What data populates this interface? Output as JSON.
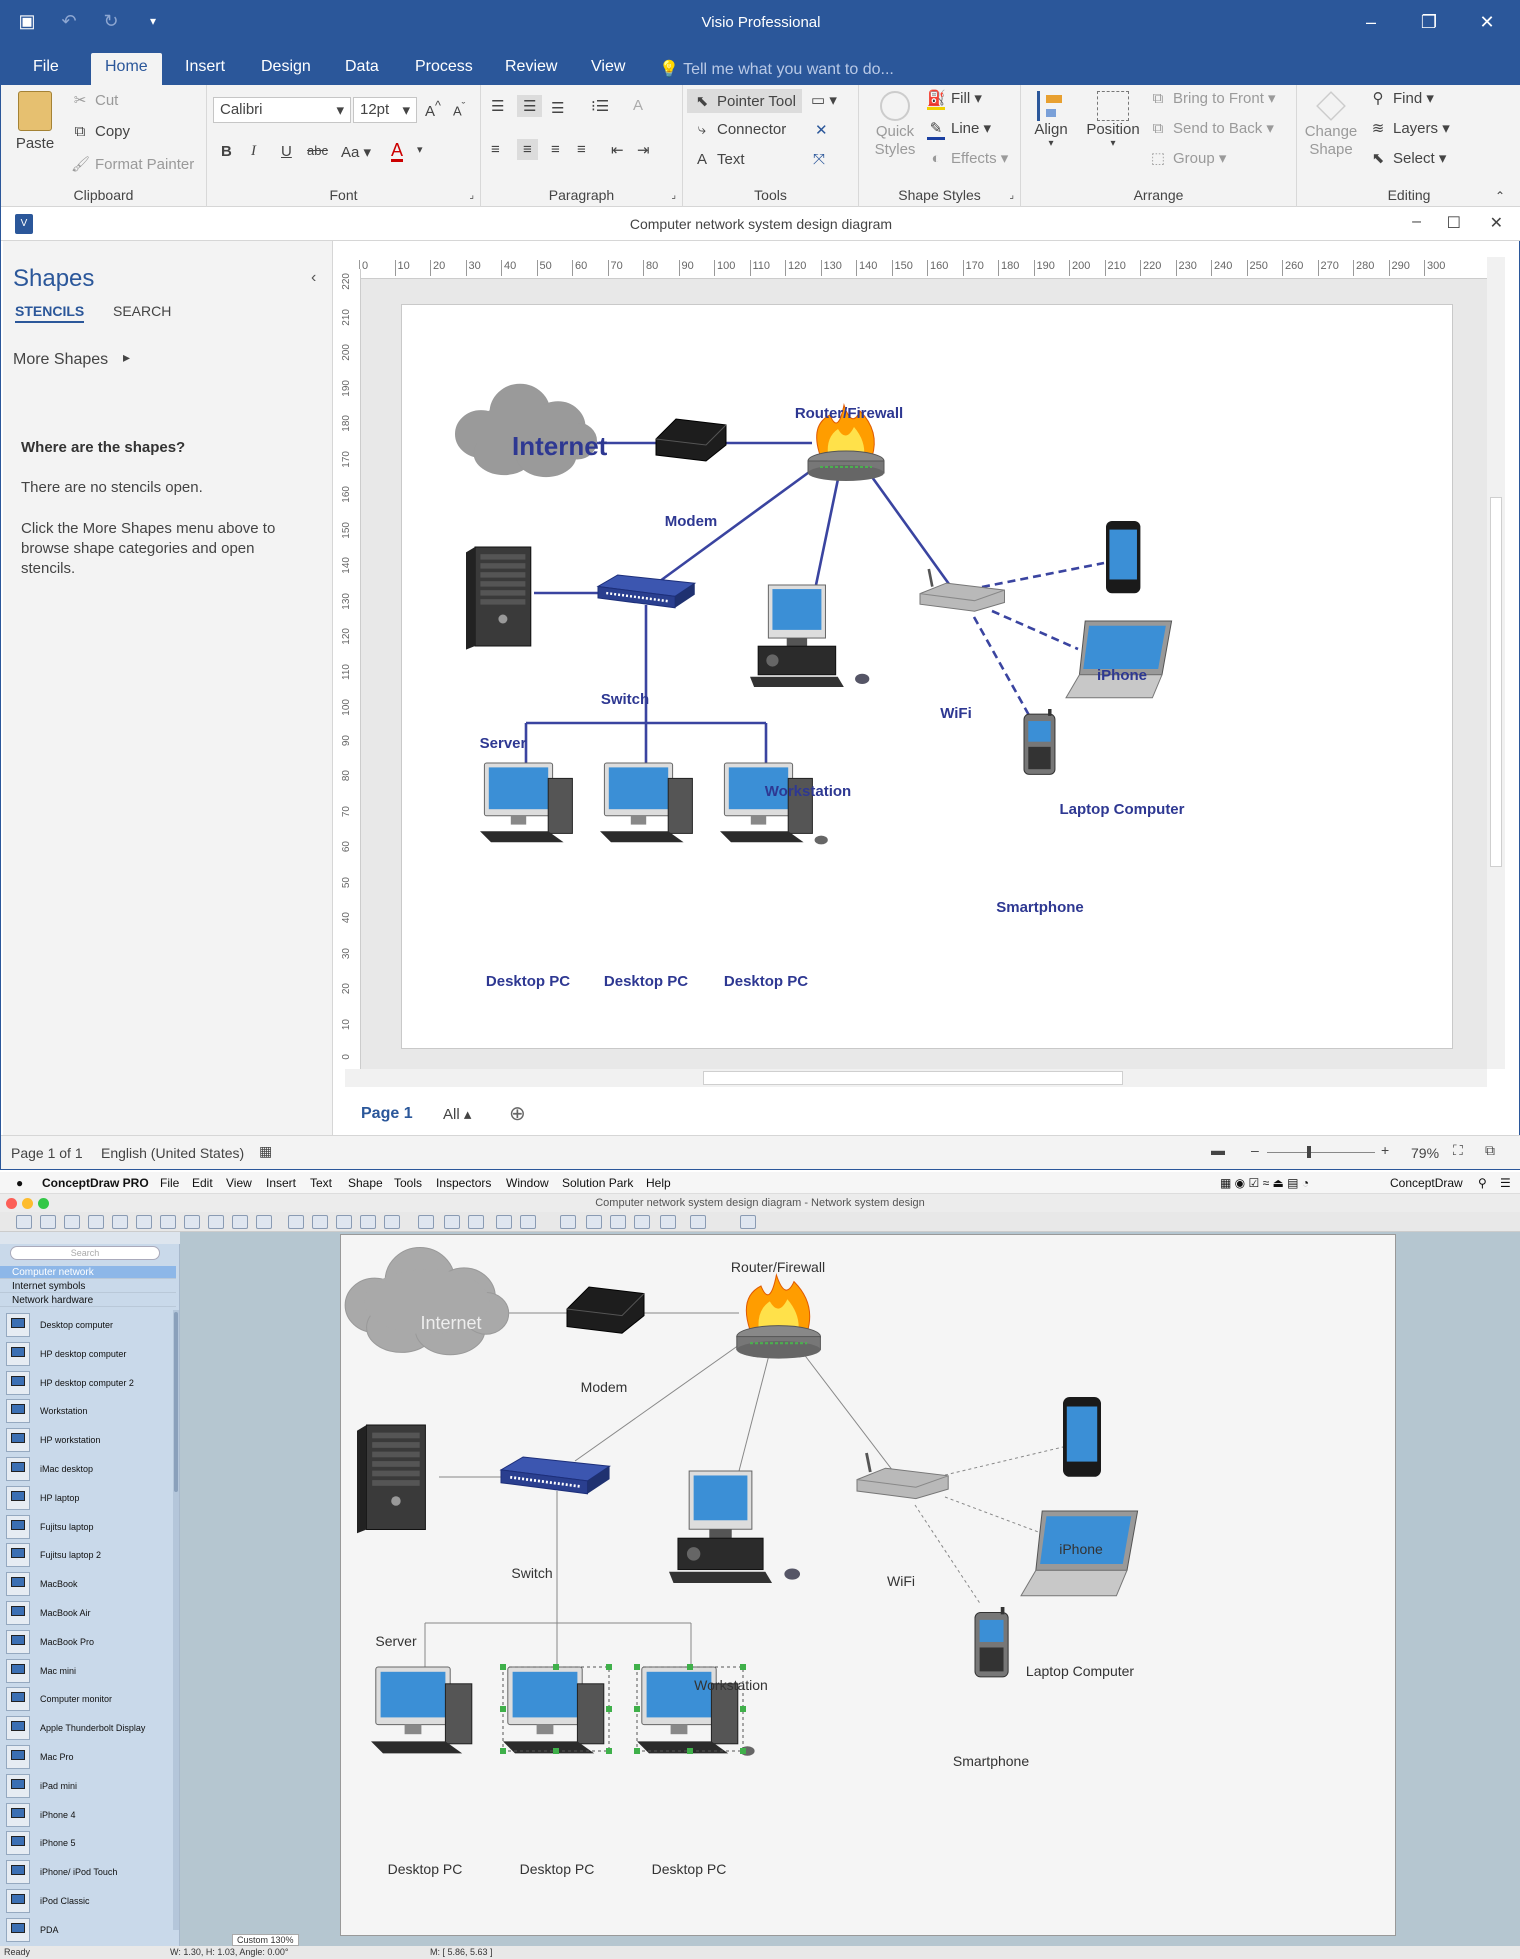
{
  "visio": {
    "app_title": "Visio Professional",
    "doc_title": "Computer network system design diagram",
    "tabs": [
      "File",
      "Home",
      "Insert",
      "Design",
      "Data",
      "Process",
      "Review",
      "View"
    ],
    "active_tab": "Home",
    "tell_me": "Tell me what you want to do...",
    "ribbon": {
      "clipboard": {
        "label": "Clipboard",
        "paste": "Paste",
        "cut": "Cut",
        "copy": "Copy",
        "format_painter": "Format Painter"
      },
      "font": {
        "label": "Font",
        "family": "Calibri",
        "size": "12pt",
        "bold": "B",
        "italic": "I",
        "underline": "U",
        "strike": "abc",
        "case": "Aa",
        "color": "A"
      },
      "paragraph": {
        "label": "Paragraph"
      },
      "tools": {
        "label": "Tools",
        "pointer": "Pointer Tool",
        "connector": "Connector",
        "text": "Text"
      },
      "shape_styles": {
        "label": "Shape Styles",
        "quick_styles": "Quick Styles",
        "fill": "Fill",
        "line": "Line",
        "effects": "Effects"
      },
      "arrange": {
        "label": "Arrange",
        "align": "Align",
        "position": "Position",
        "bring_front": "Bring to Front",
        "send_back": "Send to Back",
        "group": "Group"
      },
      "editing": {
        "label": "Editing",
        "change_shape": "Change Shape",
        "find": "Find",
        "layers": "Layers",
        "select": "Select"
      }
    },
    "shapes_pane": {
      "title": "Shapes",
      "stencils": "STENCILS",
      "search": "SEARCH",
      "more_shapes": "More Shapes",
      "where_title": "Where are the shapes?",
      "no_stencils": "There are no stencils open.",
      "click_more": "Click the More Shapes menu above to browse shape categories and open stencils."
    },
    "ruler_h": [
      "0",
      "10",
      "20",
      "30",
      "40",
      "50",
      "60",
      "70",
      "80",
      "90",
      "100",
      "110",
      "120",
      "130",
      "140",
      "150",
      "160",
      "170",
      "180",
      "190",
      "200",
      "210",
      "220",
      "230",
      "240",
      "250",
      "260",
      "270",
      "280",
      "290",
      "300"
    ],
    "ruler_v": [
      "220",
      "210",
      "200",
      "190",
      "180",
      "170",
      "160",
      "150",
      "140",
      "130",
      "120",
      "110",
      "100",
      "90",
      "80",
      "70",
      "60",
      "50",
      "40",
      "30",
      "20",
      "10",
      "0"
    ],
    "page_tab": "Page 1",
    "all_tab": "All",
    "status": {
      "page": "Page 1 of 1",
      "language": "English (United States)",
      "zoom": "79%"
    }
  },
  "diagram": {
    "internet": "Internet",
    "modem": "Modem",
    "router": "Router/Firewall",
    "server": "Server",
    "switch": "Switch",
    "workstation": "Workstation",
    "wifi": "WiFi",
    "iphone": "iPhone",
    "laptop": "Laptop Computer",
    "smartphone": "Smartphone",
    "desktop": "Desktop PC"
  },
  "conceptdraw": {
    "menu": [
      "ConceptDraw PRO",
      "File",
      "Edit",
      "View",
      "Insert",
      "Text",
      "Shape",
      "Tools",
      "Inspectors",
      "Window",
      "Solution Park",
      "Help"
    ],
    "menu_right": "ConceptDraw",
    "window_title": "Computer network system design diagram - Network system design",
    "search_placeholder": "Search",
    "categories": [
      "Computer network",
      "Internet symbols",
      "Network hardware"
    ],
    "items": [
      "Desktop computer",
      "HP desktop computer",
      "HP desktop computer 2",
      "Workstation",
      "HP workstation",
      "iMac desktop",
      "HP laptop",
      "Fujitsu laptop",
      "Fujitsu laptop 2",
      "MacBook",
      "MacBook Air",
      "MacBook Pro",
      "Mac mini",
      "Computer monitor",
      "Apple Thunderbolt Display",
      "Mac Pro",
      "iPad mini",
      "iPhone 4",
      "iPhone 5",
      "iPhone/ iPod Touch",
      "iPod Classic",
      "PDA"
    ],
    "status_left": "Ready",
    "zoom": "Custom 130%",
    "dims": "W: 1.30,  H: 1.03,  Angle: 0.00°",
    "mouse": "M: [ 5.86, 5.63 ]"
  },
  "colors": {
    "visio_blue": "#2b579a",
    "label_blue": "#2e3892",
    "line_blue": "#3a44a0"
  }
}
